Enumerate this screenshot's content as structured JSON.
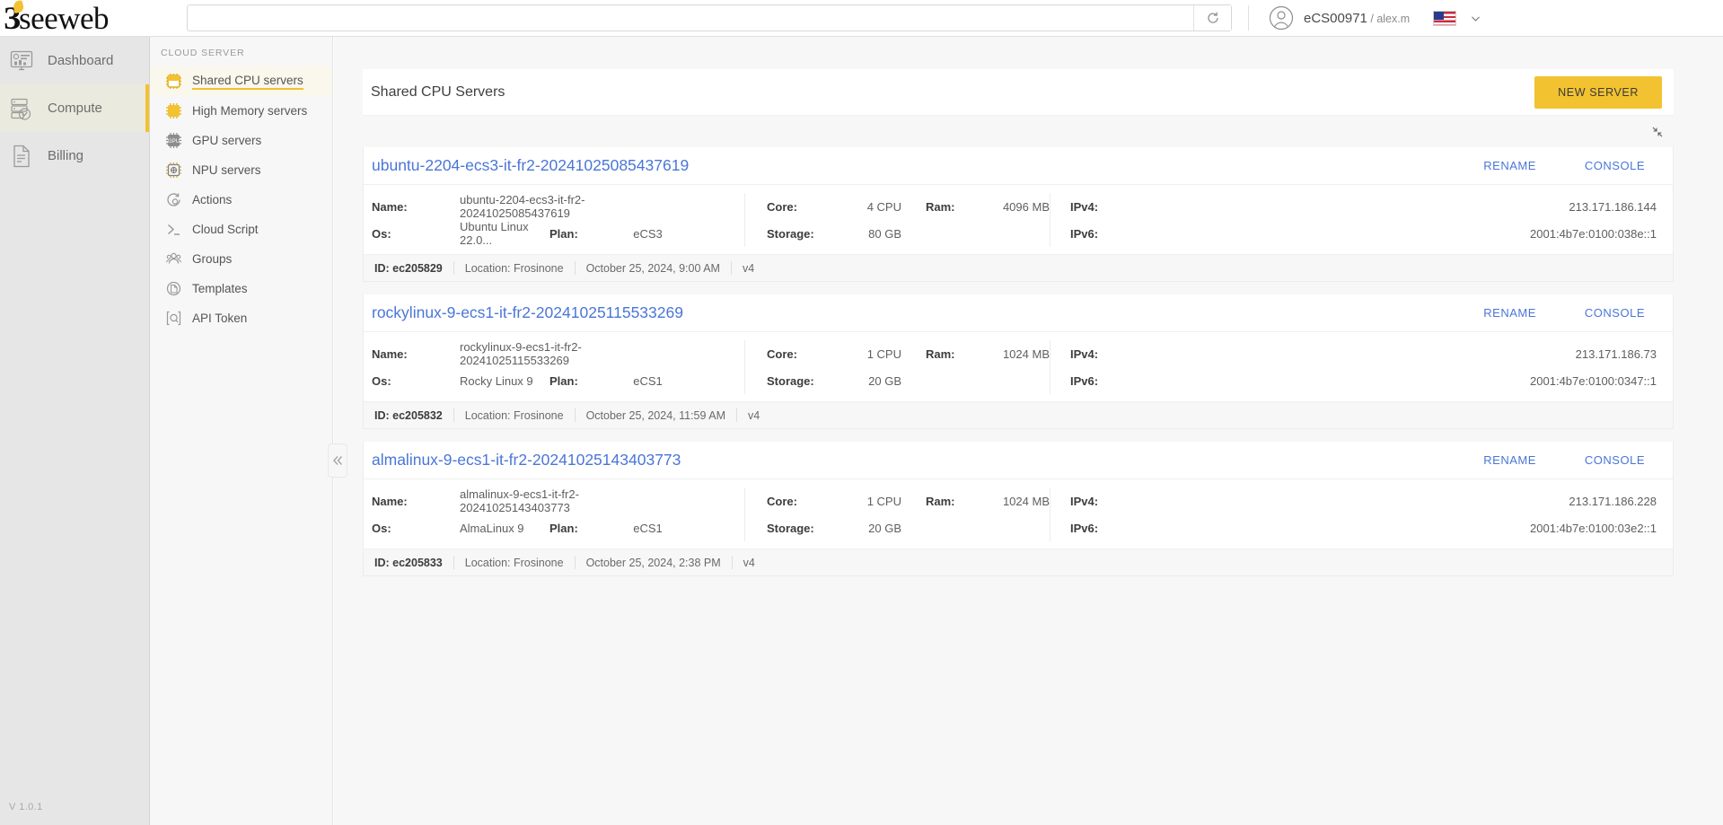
{
  "brand": {
    "name": "seeweb",
    "accent": "#f2c230"
  },
  "topbar": {
    "search": {
      "value": "",
      "placeholder": ""
    },
    "refresh_icon": "refresh-icon",
    "account_id": "eCS00971",
    "account_sep": " / ",
    "account_user": "alex.m",
    "flag": "us-flag-icon",
    "chevron": "chevron-down-icon"
  },
  "primary_nav": {
    "items": [
      {
        "label": "Dashboard",
        "icon": "dashboard-icon",
        "active": false
      },
      {
        "label": "Compute",
        "icon": "server-stack-icon",
        "active": true
      },
      {
        "label": "Billing",
        "icon": "document-icon",
        "active": false
      }
    ],
    "version": "V 1.0.1"
  },
  "sub_nav": {
    "title": "CLOUD SERVER",
    "items": [
      {
        "label": "Shared CPU servers",
        "icon": "cpu-outline-icon",
        "active": true
      },
      {
        "label": "High Memory servers",
        "icon": "cpu-filled-icon",
        "active": false
      },
      {
        "label": "GPU servers",
        "icon": "gpu-icon",
        "active": false
      },
      {
        "label": "NPU servers",
        "icon": "npu-icon",
        "active": false
      },
      {
        "label": "Actions",
        "icon": "actions-gear-icon",
        "active": false
      },
      {
        "label": "Cloud Script",
        "icon": "terminal-icon",
        "active": false
      },
      {
        "label": "Groups",
        "icon": "groups-icon",
        "active": false
      },
      {
        "label": "Templates",
        "icon": "templates-icon",
        "active": false
      },
      {
        "label": "API Token",
        "icon": "api-token-icon",
        "active": false
      }
    ],
    "collapse_icon": "chevron-double-left-icon"
  },
  "main": {
    "page_title": "Shared CPU Servers",
    "new_server_label": "NEW SERVER",
    "expand_icon": "collapse-diagonal-icon",
    "labels": {
      "name": "Name:",
      "os": "Os:",
      "plan": "Plan:",
      "core": "Core:",
      "storage": "Storage:",
      "ram": "Ram:",
      "ipv4": "IPv4:",
      "ipv6": "IPv6:",
      "rename": "RENAME",
      "console": "CONSOLE"
    },
    "servers": [
      {
        "title": "ubuntu-2204-ecs3-it-fr2-20241025085437619",
        "name": "ubuntu-2204-ecs3-it-fr2-20241025085437619",
        "os": "Ubuntu Linux 22.0...",
        "plan": "eCS3",
        "core": "4 CPU",
        "storage": "80 GB",
        "ram": "4096 MB",
        "ipv4": "213.171.186.144",
        "ipv6": "2001:4b7e:0100:038e::1",
        "id": "ID: ec205829",
        "location": "Location: Frosinone",
        "created": "October 25, 2024, 9:00 AM",
        "version": "v4"
      },
      {
        "title": "rockylinux-9-ecs1-it-fr2-20241025115533269",
        "name": "rockylinux-9-ecs1-it-fr2-20241025115533269",
        "os": "Rocky Linux 9",
        "plan": "eCS1",
        "core": "1 CPU",
        "storage": "20 GB",
        "ram": "1024 MB",
        "ipv4": "213.171.186.73",
        "ipv6": "2001:4b7e:0100:0347::1",
        "id": "ID: ec205832",
        "location": "Location: Frosinone",
        "created": "October 25, 2024, 11:59 AM",
        "version": "v4"
      },
      {
        "title": "almalinux-9-ecs1-it-fr2-20241025143403773",
        "name": "almalinux-9-ecs1-it-fr2-20241025143403773",
        "os": "AlmaLinux 9",
        "plan": "eCS1",
        "core": "1 CPU",
        "storage": "20 GB",
        "ram": "1024 MB",
        "ipv4": "213.171.186.228",
        "ipv6": "2001:4b7e:0100:03e2::1",
        "id": "ID: ec205833",
        "location": "Location: Frosinone",
        "created": "October 25, 2024, 2:38 PM",
        "version": "v4"
      }
    ]
  }
}
